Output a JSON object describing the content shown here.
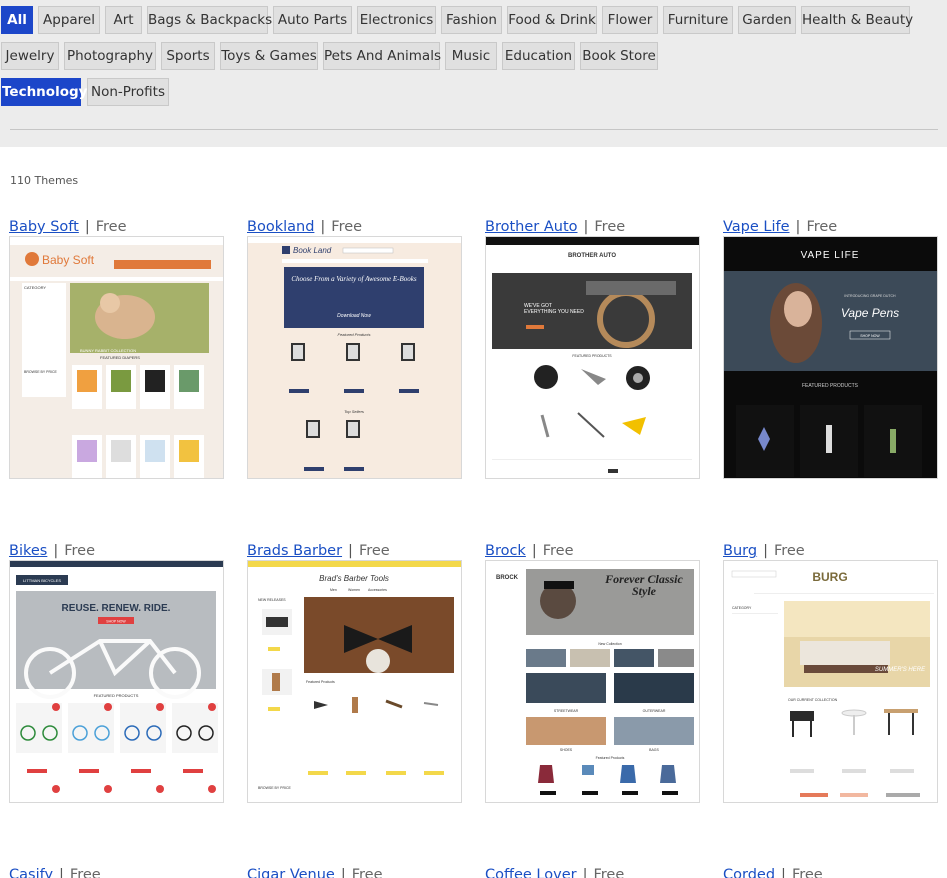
{
  "filters": {
    "tags": [
      {
        "label": "All",
        "active": true
      },
      {
        "label": "Apparel"
      },
      {
        "label": "Art"
      },
      {
        "label": "Bags & Backpacks"
      },
      {
        "label": "Auto Parts"
      },
      {
        "label": "Electronics"
      },
      {
        "label": "Fashion"
      },
      {
        "label": "Food & Drink"
      },
      {
        "label": "Flower"
      },
      {
        "label": "Furniture"
      },
      {
        "label": "Garden"
      },
      {
        "label": "Health & Beauty"
      },
      {
        "label": "Jewelry"
      },
      {
        "label": "Photography"
      },
      {
        "label": "Sports"
      },
      {
        "label": "Toys & Games"
      },
      {
        "label": "Pets And Animals"
      },
      {
        "label": "Music"
      },
      {
        "label": "Education"
      },
      {
        "label": "Book Store"
      },
      {
        "label": "Technology",
        "active": true
      },
      {
        "label": "Non-Profits"
      }
    ]
  },
  "themes_count": "110 Themes",
  "themes": [
    {
      "name": "Baby Soft",
      "price": "Free",
      "preview": {
        "logo": "Baby Soft",
        "banner": "BUNNY RABBIT COLLECTION",
        "section": "FEATURED DIAPERS",
        "sidebar_title": "CATEGORY",
        "sidebar_title_2": "BROWSE BY PRICE",
        "accent": "#e0793a"
      }
    },
    {
      "name": "Bookland",
      "price": "Free",
      "preview": {
        "logo": "Book Land",
        "banner": "Choose From a Variety of Awesome E-Books",
        "banner_cta": "Download Now",
        "section": "Featured Products",
        "section_2": "Top Sellers",
        "accent": "#2f3f6e"
      }
    },
    {
      "name": "Brother Auto",
      "price": "Free",
      "preview": {
        "logo": "BROTHER AUTO",
        "banner": "WE'VE GOT EVERYTHING YOU NEED",
        "section": "FEATURED PRODUCTS",
        "accent": "#e0793a"
      }
    },
    {
      "name": "Vape Life",
      "price": "Free",
      "preview": {
        "logo": "VAPE LIFE",
        "banner_small": "INTRODUCING GRAPE DUTCH",
        "banner": "Vape Pens",
        "banner_cta": "SHOP NOW",
        "section": "FEATURED PRODUCTS"
      }
    },
    {
      "name": "Bikes",
      "price": "Free",
      "preview": {
        "logo": "LITTMAN BICYCLES",
        "banner": "REUSE. RENEW. RIDE.",
        "banner_cta": "SHOP NOW",
        "section": "FEATURED PRODUCTS",
        "accent": "#e04040"
      }
    },
    {
      "name": "Brads Barber",
      "price": "Free",
      "preview": {
        "logo": "Brad's Barber Tools",
        "nav": [
          "Men",
          "Women",
          "Accessories"
        ],
        "sidebar_title": "NEW RELEASES",
        "section": "Featured Products",
        "sidebar_title_2": "BROWSE BY PRICE",
        "accent": "#f3d84a"
      }
    },
    {
      "name": "Brock",
      "price": "Free",
      "preview": {
        "logo": "BROCK",
        "banner": "Forever Classic Style",
        "section": "New Collection",
        "section_2": "Featured Products",
        "labels": [
          "STREETWEAR",
          "OUTERWEAR",
          "SHOES",
          "BAGS"
        ]
      }
    },
    {
      "name": "Burg",
      "price": "Free",
      "preview": {
        "logo": "BURG",
        "banner": "SUMMER'S HERE",
        "section": "OUR CURRENT COLLECTION",
        "sidebar_title": "CATEGORY"
      }
    },
    {
      "name": "Casify",
      "price": "Free"
    },
    {
      "name": "Cigar Venue",
      "price": "Free"
    },
    {
      "name": "Coffee Lover",
      "price": "Free"
    },
    {
      "name": "Corded",
      "price": "Free"
    }
  ]
}
